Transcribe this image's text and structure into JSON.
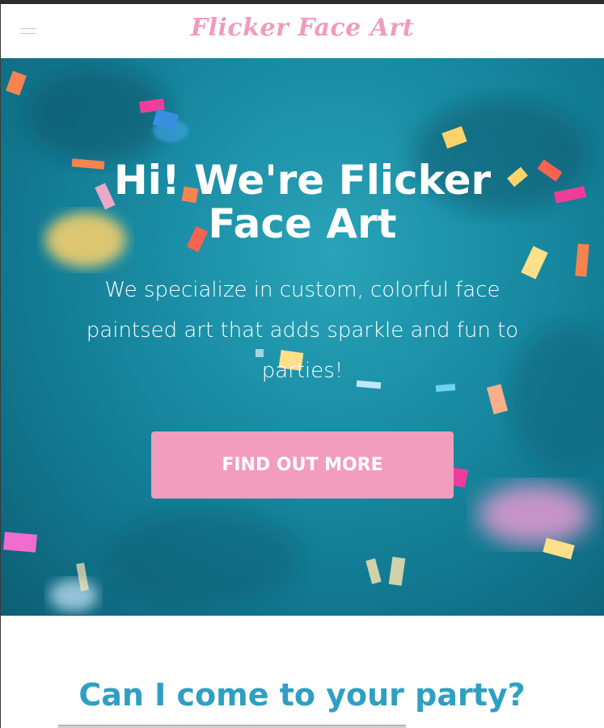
{
  "header": {
    "logo_text": "Flicker Face Art"
  },
  "hero": {
    "title_line1": "Hi! We're Flicker",
    "title_line2": "Face Art",
    "subtitle": "We specialize in custom, colorful face paintsed art that adds sparkle and fun to parties!",
    "cta_label": "FIND OUT MORE"
  },
  "section": {
    "title": "Can I come to your party?"
  },
  "colors": {
    "brand_pink": "#f29bbd",
    "cta_pink": "#f39dbd",
    "hero_teal": "#1a8ea6",
    "section_title_blue": "#2f9fc3"
  },
  "icons": {
    "menu": "hamburger-menu-icon"
  }
}
